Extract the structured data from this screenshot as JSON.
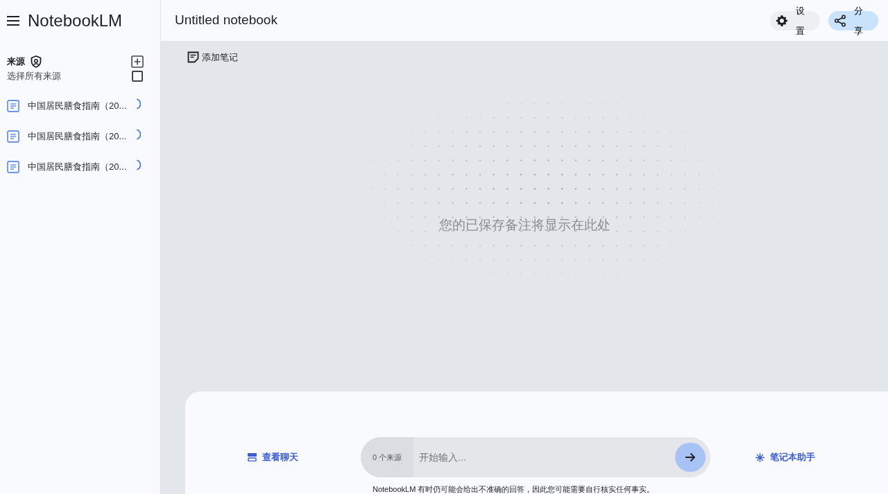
{
  "app": {
    "title": "NotebookLM"
  },
  "sources": {
    "heading": "来源",
    "select_all": {
      "label": "选择所有来源",
      "checked": false
    },
    "items": [
      {
        "title": "中国居民膳食指南（20...",
        "loading": true
      },
      {
        "title": "中国居民膳食指南（20...",
        "loading": true
      },
      {
        "title": "中国居民膳食指南（20...",
        "loading": true
      }
    ]
  },
  "notebook": {
    "title": "Untitled notebook",
    "buttons": [
      {
        "kind": "settings",
        "label": "设置"
      },
      {
        "kind": "share",
        "label": "分享"
      }
    ]
  },
  "notes": {
    "add_button": "添加笔记",
    "empty_message": "您的已保存备注将显示在此处"
  },
  "chat": {
    "view_chat": "查看聊天",
    "source_count": "0 个来源",
    "placeholder": "开始输入...",
    "assistant": "笔记本助手",
    "disclaimer": "NotebookLM 有时仍可能会给出不准确的回答，因此您可能需要自行核实任何事实。"
  }
}
